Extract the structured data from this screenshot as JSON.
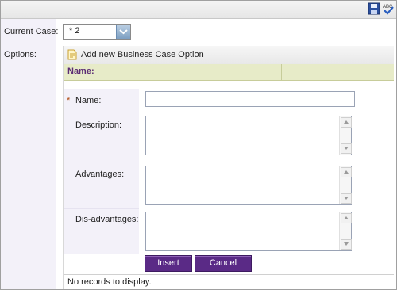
{
  "toolbar": {
    "save_icon": "save-icon",
    "spellcheck_icon": "spellcheck-icon",
    "spellcheck_text": "ABC"
  },
  "labels": {
    "current_case": "Current Case:",
    "options": "Options:"
  },
  "current_case_select": {
    "value": "* 2"
  },
  "grid": {
    "add_new_label": "Add new Business Case Option",
    "column_name_header": "Name:",
    "no_records": "No records to display."
  },
  "form": {
    "required_mark": "*",
    "name_label": "Name:",
    "name_value": "",
    "description_label": "Description:",
    "description_value": "",
    "advantages_label": "Advantages:",
    "advantages_value": "",
    "disadvantages_label": "Dis-advantages:",
    "disadvantages_value": "",
    "insert_label": "Insert",
    "cancel_label": "Cancel"
  },
  "colors": {
    "button_purple": "#5a2a86",
    "header_text_purple": "#5b2d74",
    "header_bg": "#e7ebc8",
    "label_column_bg": "#f3f1f9"
  }
}
